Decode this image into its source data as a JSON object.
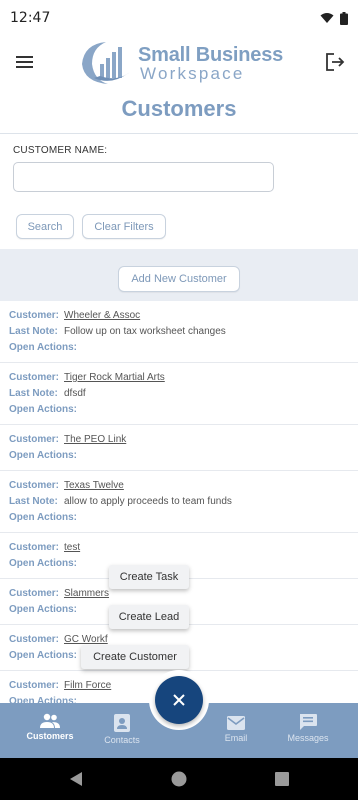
{
  "status_bar": {
    "time": "12:47"
  },
  "header": {
    "logo_line1": "Small Business",
    "logo_line2": "Workspace"
  },
  "page_title": "Customers",
  "filters": {
    "customer_name_label": "CUSTOMER NAME:",
    "customer_name_value": "",
    "search_label": "Search",
    "clear_label": "Clear Filters"
  },
  "add_new_label": "Add New Customer",
  "labels": {
    "customer": "Customer:",
    "last_note": "Last Note:",
    "open_actions": "Open Actions:"
  },
  "customers": [
    {
      "name": "Wheeler & Assoc",
      "last_note": "Follow up on tax worksheet changes"
    },
    {
      "name": "Tiger Rock Martial Arts",
      "last_note": "dfsdf"
    },
    {
      "name": "The PEO Link"
    },
    {
      "name": "Texas Twelve",
      "last_note": "allow to apply proceeds to team funds"
    },
    {
      "name": "test"
    },
    {
      "name": "Slammers"
    },
    {
      "name": "GC Workf"
    },
    {
      "name": "Film Force"
    }
  ],
  "fab_menu": {
    "create_task": "Create Task",
    "create_lead": "Create Lead",
    "create_customer": "Create Customer"
  },
  "bottom_nav": {
    "customers": "Customers",
    "contacts": "Contacts",
    "email": "Email",
    "messages": "Messages"
  },
  "colors": {
    "accent": "#7d9cc0",
    "fab": "#16457d",
    "band": "#e9edf3"
  },
  "icons": {
    "menu": "menu-icon",
    "logout": "logout-icon",
    "fab": "close-icon",
    "customers": "people-icon",
    "contacts": "contacts-icon",
    "email": "email-icon",
    "messages": "messages-icon"
  }
}
